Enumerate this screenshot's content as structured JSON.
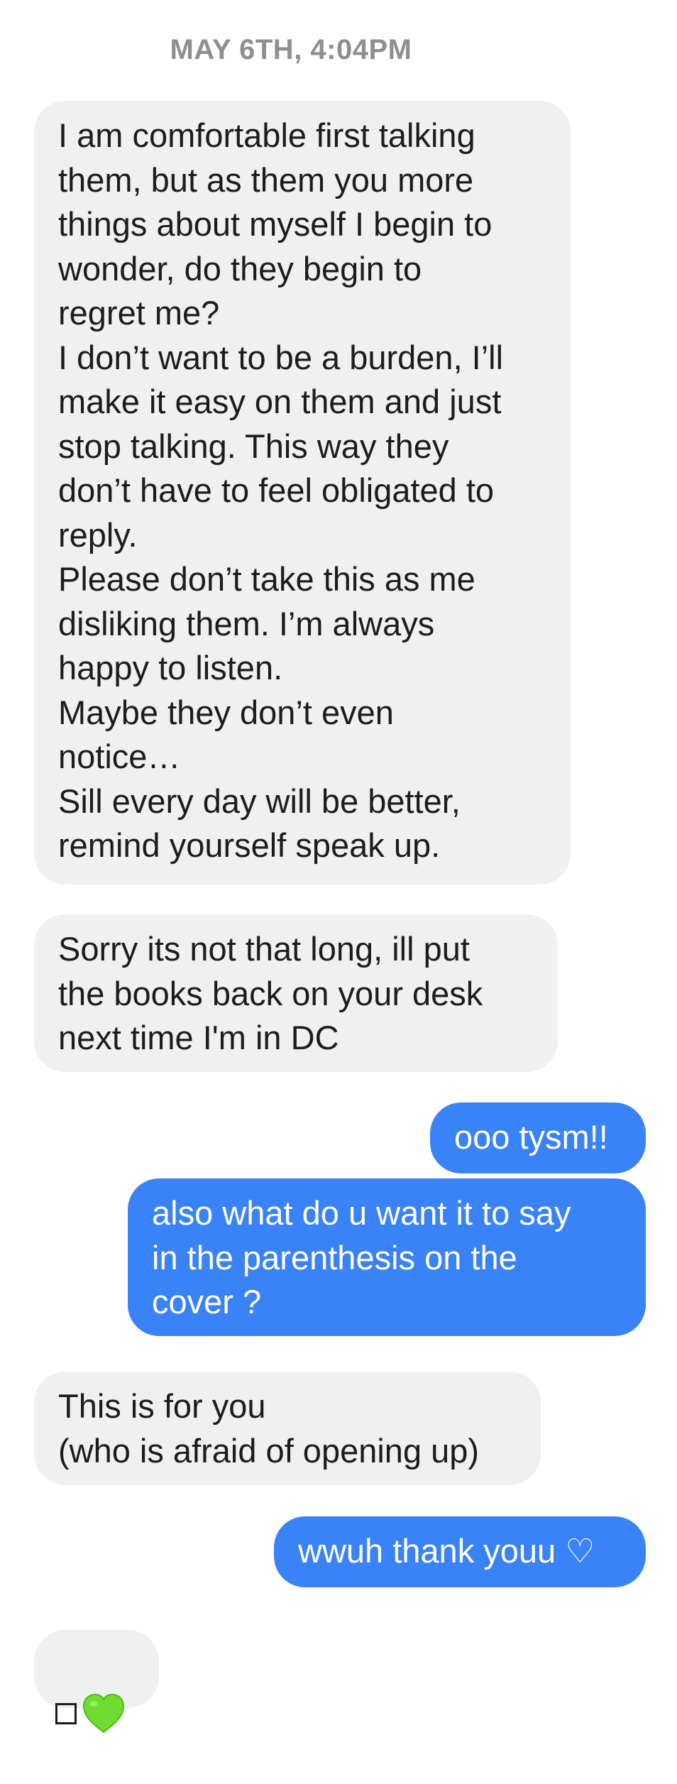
{
  "timestamp": "MAY 6TH, 4:04PM",
  "messages": [
    {
      "direction": "incoming",
      "text": "I am comfortable first talking\nthem, but as them you more\nthings about myself I begin to\nwonder, do they begin to\nregret me?\nI don’t want to be a burden, I’ll\nmake it easy on them and just\nstop talking. This way they\ndon’t have to feel obligated to\nreply.\nPlease don’t take this as me\ndisliking them. I’m always\nhappy to listen.\nMaybe they don’t even\nnotice…\nSill every day will be better,\nremind yourself speak up."
    },
    {
      "direction": "incoming",
      "text": "Sorry its not that long, ill put\nthe books back on your desk\nnext time I'm in DC"
    },
    {
      "direction": "outgoing",
      "text": "ooo tysm!!"
    },
    {
      "direction": "outgoing",
      "text": "also what do u want it to say\nin the parenthesis on the\ncover ?"
    },
    {
      "direction": "incoming",
      "text": "This is for you\n(who is afraid of opening up)"
    },
    {
      "direction": "outgoing",
      "text": "wwuh thank youu ♡"
    },
    {
      "direction": "incoming",
      "icons": [
        "missing-glyph-square-icon",
        "green-heart-icon"
      ]
    }
  ],
  "colors": {
    "incoming_bubble": "#f0f0f0",
    "outgoing_bubble": "#3a82f7",
    "timestamp": "#8e8e93",
    "green_heart": "#6fdc2f"
  }
}
